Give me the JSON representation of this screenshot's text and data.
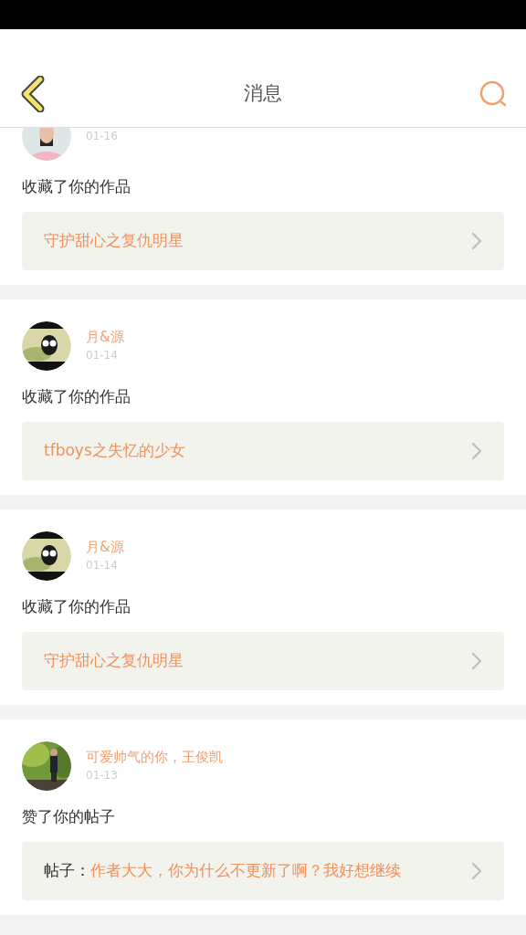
{
  "header": {
    "title": "消息"
  },
  "notifications": [
    {
      "date": "01-16",
      "action": "收藏了你的作品",
      "target": {
        "kind": "work",
        "title": "守护甜心之复仇明星"
      }
    },
    {
      "name": "月&源",
      "date": "01-14",
      "action": "收藏了你的作品",
      "target": {
        "kind": "work",
        "title": "tfboys之失忆的少女"
      }
    },
    {
      "name": "月&源",
      "date": "01-14",
      "action": "收藏了你的作品",
      "target": {
        "kind": "work",
        "title": "守护甜心之复仇明星"
      }
    },
    {
      "name": "可爱帅气的你，王俊凯",
      "date": "01-13",
      "action": "赞了你的帖子",
      "target": {
        "kind": "post",
        "label": "帖子：",
        "title": "作者大大，你为什么不更新了啊？我好想继续"
      }
    }
  ]
}
